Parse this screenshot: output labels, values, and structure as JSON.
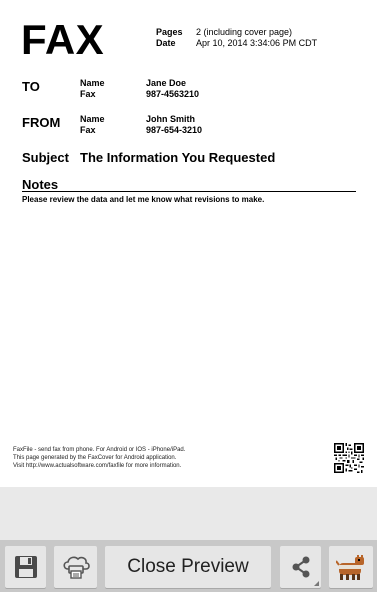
{
  "header": {
    "fax_title": "FAX",
    "pages_label": "Pages",
    "pages_value": "2 (including cover page)",
    "date_label": "Date",
    "date_value": "Apr 10, 2014 3:34:06 PM CDT"
  },
  "to": {
    "section_label": "TO",
    "name_label": "Name",
    "name_value": "Jane Doe",
    "fax_label": "Fax",
    "fax_value": "987-4563210"
  },
  "from": {
    "section_label": "FROM",
    "name_label": "Name",
    "name_value": "John Smith",
    "fax_label": "Fax",
    "fax_value": "987-654-3210"
  },
  "subject": {
    "label": "Subject",
    "value": "The Information You Requested"
  },
  "notes": {
    "label": "Notes",
    "text": "Please review the data and let me know what revisions to make."
  },
  "footer": {
    "line1": "FaxFile - send fax from phone. For Android or IOS - iPhone/iPad.",
    "line2": "This page generated by the FaxCover for Android application.",
    "line3": "Visit http://www.actualsoftware.com/faxfile for more information."
  },
  "toolbar": {
    "save_icon": "floppy-disk-icon",
    "print_icon": "cloud-print-icon",
    "close_label": "Close Preview",
    "share_icon": "share-icon",
    "app_icon": "app-logo-icon"
  }
}
